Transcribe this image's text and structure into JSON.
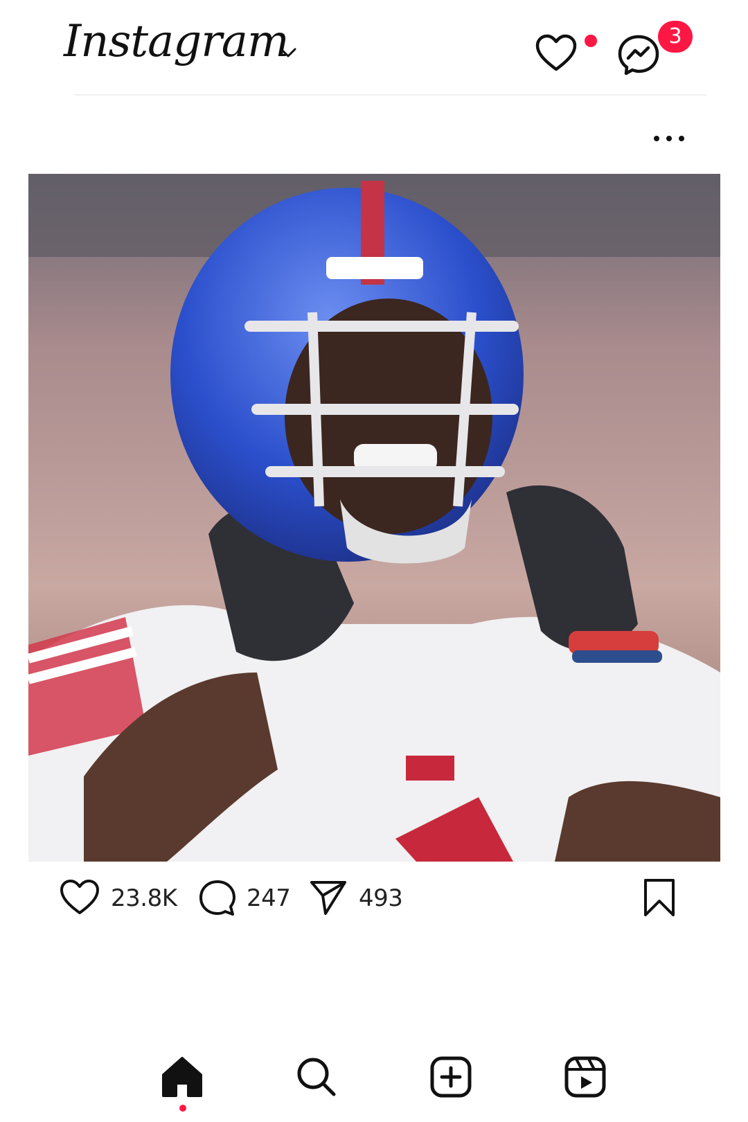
{
  "header": {
    "app_name": "Instagram",
    "messages_badge": "3",
    "icons": [
      "chevron-down-icon",
      "heart-icon",
      "messenger-icon"
    ],
    "accent_color": "#ff1744"
  },
  "post": {
    "likes": "23.8K",
    "comments": "247",
    "shares": "493",
    "image_subject": "football player in blue helmet and white jersey",
    "icons": [
      "more-options-icon",
      "heart-icon",
      "comment-icon",
      "share-icon",
      "bookmark-icon"
    ]
  },
  "bottom_nav": {
    "items": [
      "home",
      "search",
      "create",
      "reels"
    ],
    "active": "home"
  }
}
